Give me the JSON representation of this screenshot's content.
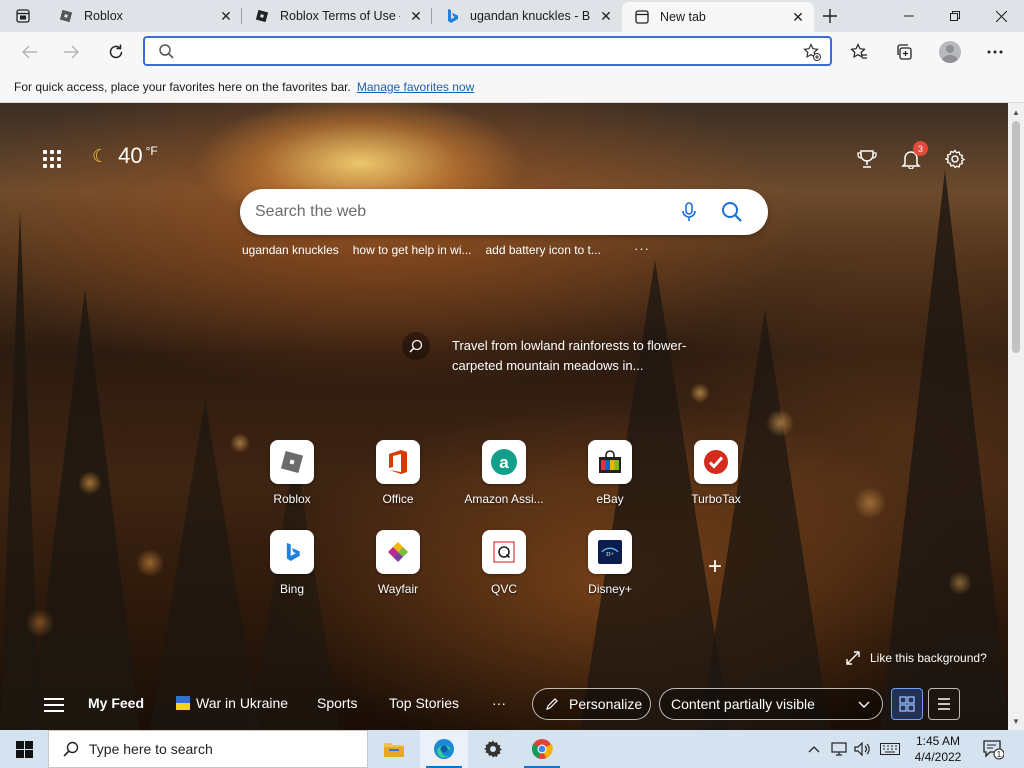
{
  "browser": {
    "tabs": [
      {
        "title": "Roblox",
        "active": false
      },
      {
        "title": "Roblox Terms of Use – R",
        "active": false
      },
      {
        "title": "ugandan knuckles - Bin",
        "active": false
      },
      {
        "title": "New tab",
        "active": true
      }
    ],
    "address_placeholder": ""
  },
  "favorites_bar": {
    "message": "For quick access, place your favorites here on the favorites bar.",
    "link": "Manage favorites now"
  },
  "newtab": {
    "weather": {
      "temperature": "40",
      "unit": "°F",
      "icon": "moon-icon"
    },
    "notifications_count": "3",
    "search": {
      "placeholder": "Search the web"
    },
    "recent_searches": [
      "ugandan knuckles",
      "how to get help in wi...",
      "add battery icon to t..."
    ],
    "more_label": "···",
    "background_info": "Travel from lowland rainforests to flower-carpeted mountain meadows in...",
    "quick_links": [
      {
        "name": "Roblox",
        "icon": "roblox-icon"
      },
      {
        "name": "Office",
        "icon": "office-icon"
      },
      {
        "name": "Amazon Assi...",
        "icon": "amazon-icon"
      },
      {
        "name": "eBay",
        "icon": "ebay-icon"
      },
      {
        "name": "TurboTax",
        "icon": "turbotax-icon"
      },
      {
        "name": "Bing",
        "icon": "bing-icon"
      },
      {
        "name": "Wayfair",
        "icon": "wayfair-icon"
      },
      {
        "name": "QVC",
        "icon": "qvc-icon"
      },
      {
        "name": "Disney+",
        "icon": "disney-plus-icon"
      }
    ],
    "like_background": "Like this background?",
    "feed": {
      "my_feed": "My Feed",
      "items": [
        "War in Ukraine",
        "Sports",
        "Top Stories"
      ],
      "more": "···",
      "personalize": "Personalize",
      "content_visibility": "Content partially visible"
    }
  },
  "taskbar": {
    "search_placeholder": "Type here to search",
    "time": "1:45 AM",
    "date": "4/4/2022",
    "notification_count": "1"
  }
}
